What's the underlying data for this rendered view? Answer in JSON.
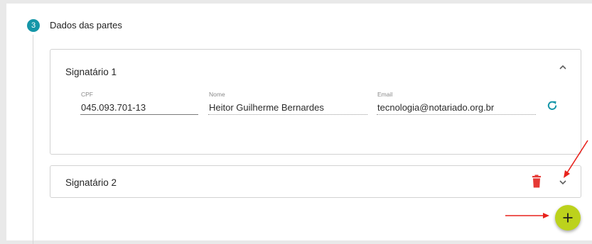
{
  "step": {
    "number": "3",
    "title": "Dados das partes",
    "accent_color": "#1596a8"
  },
  "signatarios": [
    {
      "title": "Signatário 1",
      "expanded": true,
      "fields": {
        "cpf": {
          "label": "CPF",
          "value": "045.093.701-13"
        },
        "nome": {
          "label": "Nome",
          "value": "Heitor Guilherme Bernardes"
        },
        "email": {
          "label": "Email",
          "value": "tecnologia@notariado.org.br"
        }
      },
      "icons": {
        "refresh": "refresh-icon",
        "collapse": "chevron-up-icon"
      }
    },
    {
      "title": "Signatário 2",
      "expanded": false,
      "icons": {
        "delete": "trash-icon",
        "expand": "chevron-down-icon"
      }
    }
  ],
  "add_button": {
    "icon": "plus-icon",
    "color": "#bcd21c"
  },
  "colors": {
    "refresh": "#1596a8",
    "delete": "#e53935",
    "annotation_arrow": "#e8221c"
  }
}
